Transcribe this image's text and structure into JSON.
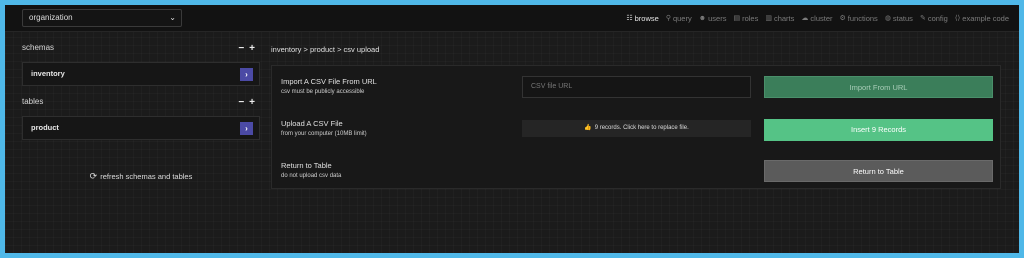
{
  "topbar": {
    "org_selected": "organization",
    "nav": [
      {
        "label": "browse",
        "icon": "list-icon",
        "glyph": "☷",
        "active": true
      },
      {
        "label": "query",
        "icon": "search-icon",
        "glyph": "⚲",
        "active": false
      },
      {
        "label": "users",
        "icon": "users-icon",
        "glyph": "☻",
        "active": false
      },
      {
        "label": "roles",
        "icon": "roles-icon",
        "glyph": "▤",
        "active": false
      },
      {
        "label": "charts",
        "icon": "chart-icon",
        "glyph": "▥",
        "active": false
      },
      {
        "label": "cluster",
        "icon": "cluster-icon",
        "glyph": "☁",
        "active": false
      },
      {
        "label": "functions",
        "icon": "functions-icon",
        "glyph": "⚙",
        "active": false
      },
      {
        "label": "status",
        "icon": "status-icon",
        "glyph": "◍",
        "active": false
      },
      {
        "label": "config",
        "icon": "wrench-icon",
        "glyph": "✎",
        "active": false
      },
      {
        "label": "example code",
        "icon": "code-icon",
        "glyph": "⟨⟩",
        "active": false
      }
    ]
  },
  "sidebar": {
    "schemas_label": "schemas",
    "schema_item": "inventory",
    "tables_label": "tables",
    "table_item": "product",
    "refresh_label": "refresh schemas and tables"
  },
  "breadcrumb": "inventory > product > csv upload",
  "rows": {
    "url": {
      "title": "Import A CSV File From URL",
      "subtitle": "csv must be publicly accessible",
      "placeholder": "CSV file URL",
      "button": "Import From URL"
    },
    "upload": {
      "title": "Upload A CSV File",
      "subtitle": "from your computer (10MB limit)",
      "file_status": "9 records. Click here to replace file.",
      "button": "Insert 9 Records"
    },
    "return": {
      "title": "Return to Table",
      "subtitle": "do not upload csv data",
      "button": "Return to Table"
    }
  },
  "colors": {
    "accent_purple": "#4b4aa5",
    "import_green": "#3b7e5a",
    "insert_green": "#55c386",
    "neutral_button": "#5b5b5b"
  }
}
